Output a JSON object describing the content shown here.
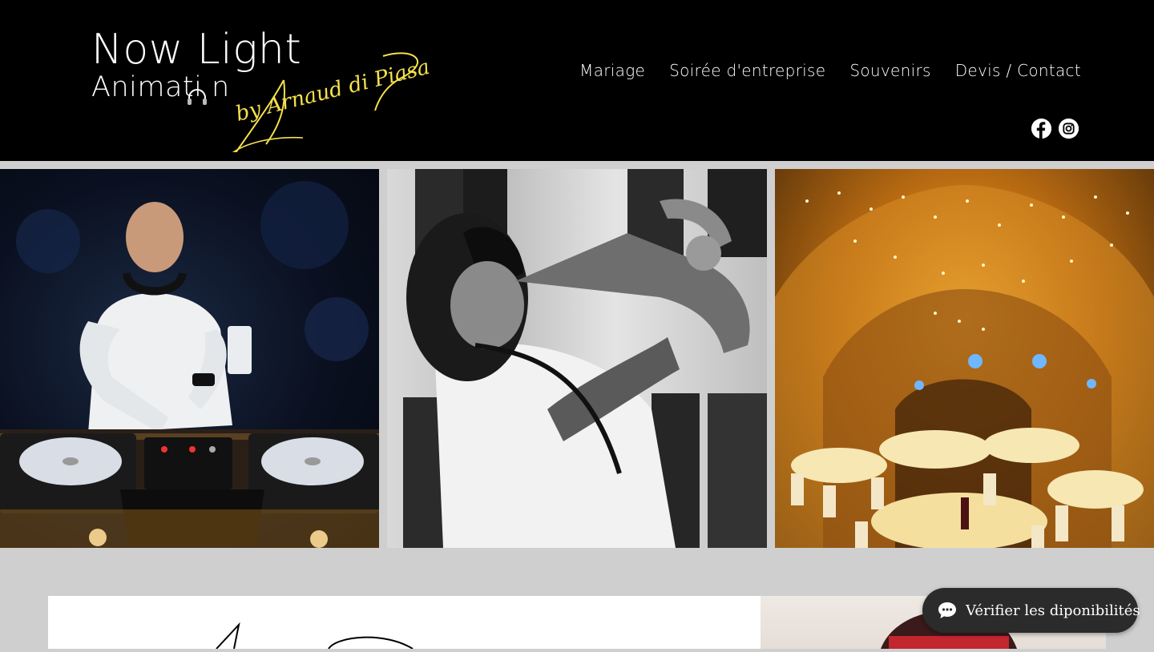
{
  "logo": {
    "line1": "Now Light",
    "line2": "Animati n",
    "signature": "by Arnaud di Piasa"
  },
  "nav": {
    "items": [
      {
        "label": "Mariage"
      },
      {
        "label": "Soirée d'entreprise"
      },
      {
        "label": "Souvenirs"
      },
      {
        "label": "Devis / Contact"
      }
    ]
  },
  "social": [
    "facebook-icon",
    "instagram-icon"
  ],
  "gallery": {
    "photos": [
      "dj-at-turntables",
      "saxophonist-black-white",
      "vaulted-cellar-reception"
    ]
  },
  "chat": {
    "label": "Vérifier les diponibilités",
    "icon": "chat-bubble-icon"
  },
  "colors": {
    "header_bg": "#000000",
    "accent_script": "#f4e04d",
    "page_bg": "#cfcfcf",
    "chat_bg": "#2b2b2b"
  }
}
